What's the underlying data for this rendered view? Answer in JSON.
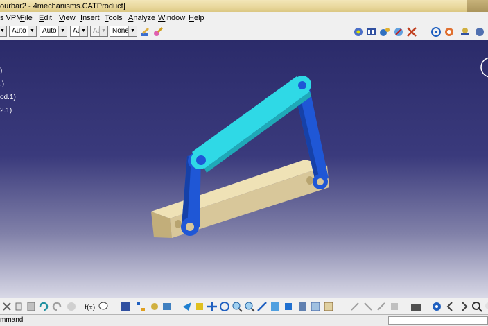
{
  "window": {
    "title": "ourbar2 - 4mechanisms.CATProduct]"
  },
  "menu": {
    "items": [
      "s VPM",
      "File",
      "Edit",
      "View",
      "Insert",
      "Tools",
      "Analyze",
      "Window",
      "Help"
    ]
  },
  "toolbar": {
    "combos": [
      {
        "value": "Auto",
        "disabled": false
      },
      {
        "value": "Auto",
        "disabled": false
      },
      {
        "value": "Aut",
        "disabled": false
      },
      {
        "value": "Aut",
        "disabled": true
      },
      {
        "value": "None",
        "disabled": false
      }
    ]
  },
  "tree": {
    "items": [
      ")",
      ".)",
      "od.1)",
      "2.1)"
    ]
  },
  "status": {
    "command": "mmand"
  },
  "colors": {
    "background_top": "#2b2b6a",
    "background_bottom": "#d8d8e6",
    "crank": "#1f57d6",
    "coupler": "#2fd9e6",
    "ground": "#d8c79a"
  }
}
